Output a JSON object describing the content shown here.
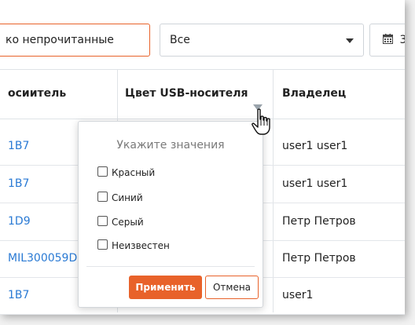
{
  "toolbar": {
    "unread_label": "ко непрочитанные",
    "filter_select_value": "Все",
    "date_partial": "3",
    "date_icon": "calendar-icon"
  },
  "table": {
    "headers": [
      "осиитель",
      "Цвет USB-носителя",
      "Владелец"
    ],
    "rows": [
      {
        "id": "1B7",
        "owner": "user1 user1"
      },
      {
        "id": "1B7",
        "owner": "user1 user1"
      },
      {
        "id": "1D9",
        "owner": "Петр Петров"
      },
      {
        "id": "MIL300059D",
        "owner": "Петр Петров"
      },
      {
        "id": "1B7",
        "owner": "user1"
      }
    ]
  },
  "filter_popup": {
    "title": "Укажите значения",
    "options": [
      "Красный",
      "Синий",
      "Серый",
      "Неизвестен"
    ],
    "apply_label": "Применить",
    "cancel_label": "Отмена"
  },
  "colors": {
    "accent": "#e8622a",
    "link": "#2a7ad4",
    "border": "#dfe3e7"
  }
}
